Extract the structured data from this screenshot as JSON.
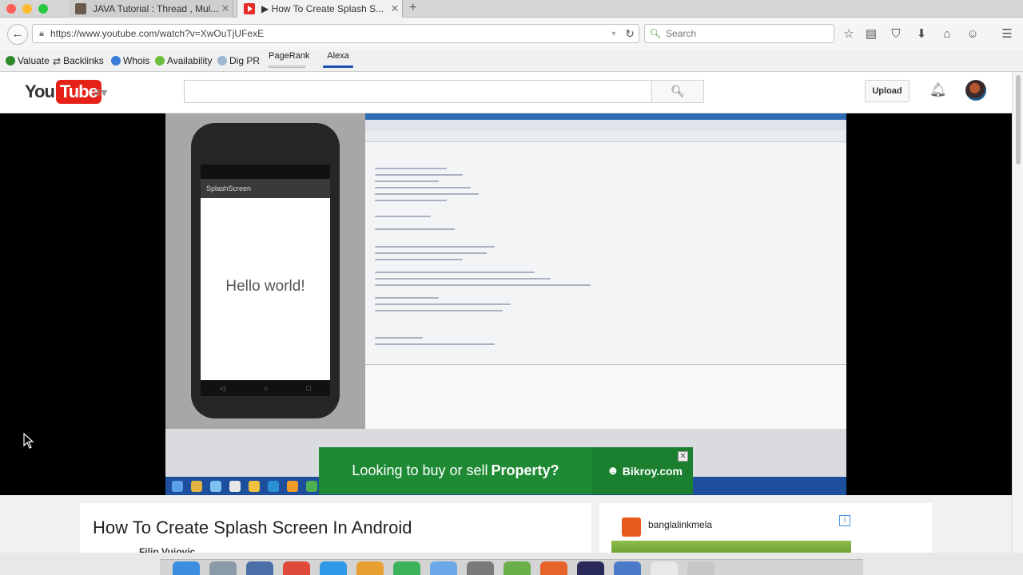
{
  "browser": {
    "tabs": [
      {
        "title": "JAVA Tutorial : Thread , Mul...",
        "active": false
      },
      {
        "title": "How To Create Splash S...",
        "active": true
      }
    ],
    "new_tab": "+",
    "close_glyph": "✕",
    "url": "https://www.youtube.com/watch?v=XwOuTjUFexE",
    "search_placeholder": "Search",
    "toolbar_icons": [
      "bookmark-star-icon",
      "reading-list-icon",
      "pocket-icon",
      "download-icon",
      "home-icon",
      "chat-icon",
      "menu-icon"
    ]
  },
  "extensions": {
    "items": [
      "Valuate",
      "Backlinks",
      "Whois",
      "Availability",
      "Dig PR"
    ],
    "pagerank_label": "PageRank",
    "alexa_label": "Alexa"
  },
  "youtube": {
    "logo_you": "You",
    "logo_tube": "Tube",
    "upload_label": "Upload",
    "video_title": "How To Create Splash Screen In Android",
    "channel_name": "Filip Vujovic",
    "player": {
      "app_title": "SplashScreen",
      "hello_text": "Hello world!"
    },
    "ad": {
      "text": "Looking to buy or sell",
      "strong": "Property?",
      "brand": "Bikroy.com"
    },
    "sidebar": {
      "channel": "banglalinkmela",
      "info": "i"
    }
  },
  "colors": {
    "youtube_red": "#e62117",
    "ad_green": "#1e8a34",
    "alexa_blue": "#1f50b5"
  }
}
